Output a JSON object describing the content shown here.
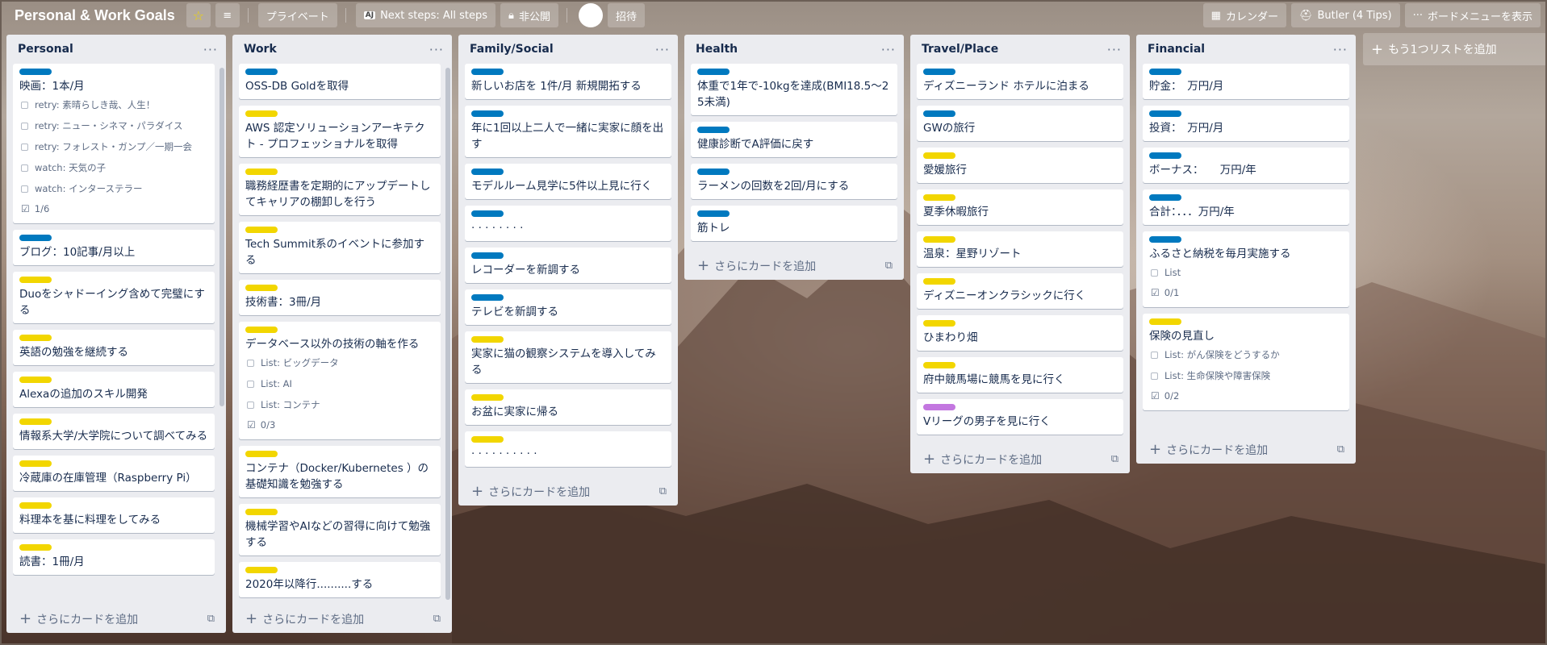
{
  "header": {
    "board_title": "Personal & Work Goals",
    "private_label": "プライベート",
    "nextsteps_icon": "AJ",
    "nextsteps_label": "Next steps: All steps",
    "visibility_label": "非公開",
    "invite_label": "招待",
    "calendar_label": "カレンダー",
    "butler_label": "Butler (4 Tips)",
    "menu_label": "ボードメニューを表示"
  },
  "add_card_label": "さらにカードを追加",
  "add_list_label": "もう1つリストを追加",
  "lists": [
    {
      "title": "Personal",
      "cards": [
        {
          "label": "blue",
          "title": "映画：1本/月",
          "checks": [
            "retry: 素晴らしき哉、人生！",
            "retry: ニュー・シネマ・パラダイス",
            "retry: フォレスト・ガンプ／一期一会",
            "watch: 天気の子",
            "watch: インターステラー"
          ],
          "badge": "1/6"
        },
        {
          "label": "blue",
          "title": "ブログ：10記事/月以上"
        },
        {
          "label": "yellow",
          "title": "Duoをシャドーイング含めて完璧にする"
        },
        {
          "label": "yellow",
          "title": "英語の勉強を継続する"
        },
        {
          "label": "yellow",
          "title": "Alexaの追加のスキル開発"
        },
        {
          "label": "yellow",
          "title": "情報系大学/大学院について調べてみる"
        },
        {
          "label": "yellow",
          "title": "冷蔵庫の在庫管理（Raspberry Pi）"
        },
        {
          "label": "yellow",
          "title": "料理本を基に料理をしてみる"
        },
        {
          "label": "yellow",
          "title": "読書：1冊/月"
        }
      ]
    },
    {
      "title": "Work",
      "cards": [
        {
          "label": "blue",
          "title": "OSS-DB Goldを取得"
        },
        {
          "label": "yellow",
          "title": "AWS 認定ソリューションアーキテクト - プロフェッショナルを取得"
        },
        {
          "label": "yellow",
          "title": "職務経歴書を定期的にアップデートしてキャリアの棚卸しを行う"
        },
        {
          "label": "yellow",
          "title": "Tech Summit系のイベントに参加する"
        },
        {
          "label": "yellow",
          "title": "技術書：3冊/月"
        },
        {
          "label": "yellow",
          "title": "データベース以外の技術の軸を作る",
          "checks": [
            "List: ビッグデータ",
            "List: AI",
            "List: コンテナ"
          ],
          "badge": "0/3"
        },
        {
          "label": "yellow",
          "title": "コンテナ（Docker/Kubernetes ）の基礎知識を勉強する"
        },
        {
          "label": "yellow",
          "title": "機械学習やAIなどの習得に向けて勉強する"
        },
        {
          "label": "yellow",
          "title": "2020年以降行..........する"
        }
      ]
    },
    {
      "title": "Family/Social",
      "cards": [
        {
          "label": "blue",
          "title": "新しいお店を 1件/月 新規開拓する"
        },
        {
          "label": "blue",
          "title": "年に1回以上二人で一緒に実家に顔を出す"
        },
        {
          "label": "blue",
          "title": "モデルルーム見学に5件以上見に行く"
        },
        {
          "label": "blue",
          "title": "· · · · · · · ·"
        },
        {
          "label": "blue",
          "title": "レコーダーを新調する"
        },
        {
          "label": "blue",
          "title": "テレビを新調する"
        },
        {
          "label": "yellow",
          "title": "実家に猫の観察システムを導入してみる"
        },
        {
          "label": "yellow",
          "title": "お盆に実家に帰る"
        },
        {
          "label": "yellow",
          "title": "· · · · · · · · · ·"
        }
      ]
    },
    {
      "title": "Health",
      "cards": [
        {
          "label": "blue",
          "title": "体重で1年で-10kgを達成(BMI18.5～25未満)"
        },
        {
          "label": "blue",
          "title": "健康診断でA評価に戻す"
        },
        {
          "label": "blue",
          "title": "ラーメンの回数を2回/月にする"
        },
        {
          "label": "blue",
          "title": "筋トレ"
        }
      ]
    },
    {
      "title": "Travel/Place",
      "cards": [
        {
          "label": "blue",
          "title": "ディズニーランド ホテルに泊まる"
        },
        {
          "label": "blue",
          "title": "GWの旅行"
        },
        {
          "label": "yellow",
          "title": "愛媛旅行"
        },
        {
          "label": "yellow",
          "title": "夏季休暇旅行"
        },
        {
          "label": "yellow",
          "title": "温泉：星野リゾート"
        },
        {
          "label": "yellow",
          "title": "ディズニーオンクラシックに行く"
        },
        {
          "label": "yellow",
          "title": "ひまわり畑"
        },
        {
          "label": "yellow",
          "title": "府中競馬場に競馬を見に行く"
        },
        {
          "label": "purple",
          "title": "Vリーグの男子を見に行く"
        }
      ]
    },
    {
      "title": "Financial",
      "cards": [
        {
          "label": "blue",
          "title": "貯金：　万円/月"
        },
        {
          "label": "blue",
          "title": "投資：　万円/月"
        },
        {
          "label": "blue",
          "title": "ボーナス：　　万円/年"
        },
        {
          "label": "blue",
          "title": "合計：．．．万円/年"
        },
        {
          "label": "blue",
          "title": "ふるさと納税を毎月実施する",
          "checks": [
            "List"
          ],
          "badge": "0/1"
        },
        {
          "label": "yellow",
          "title": "保険の見直し",
          "checks": [
            "List: がん保険をどうするか",
            "List: 生命保険や障害保険"
          ],
          "badge": "0/2"
        }
      ]
    }
  ]
}
